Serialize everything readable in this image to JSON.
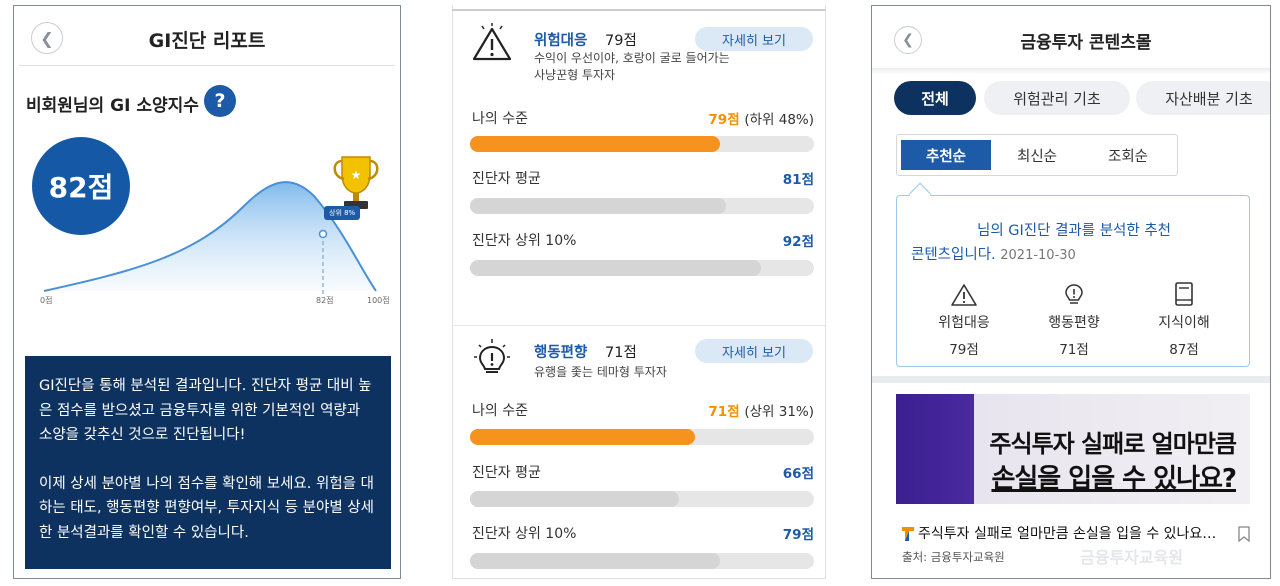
{
  "panel1": {
    "title": "GI진단 리포트",
    "index_title": "비회원님의 GI 소양지수",
    "help_symbol": "?",
    "score": "82점",
    "rank_badge": "상위 8%",
    "axis": {
      "min": "0점",
      "mark": "82점",
      "max": "100점"
    },
    "info_paragraph1": "GI진단을 통해 분석된 결과입니다. 진단자 평균 대비 높은 점수를 받으셨고 금융투자를 위한 기본적인 역량과 소양을 갖추신 것으로 진단됩니다!",
    "info_paragraph2": "이제 상세 분야별 나의 점수를 확인해 보세요. 위험을 대하는 태도, 행동편향 편향여부, 투자지식 등 분야별 상세한 분석결과를 확인할 수 있습니다."
  },
  "panel2": {
    "categories": [
      {
        "name": "위험대응",
        "score": "79점",
        "detail_button": "자세히 보기",
        "desc1": "수익이 우선이야, 호랑이 굴로 들어가는",
        "desc2": "사냥꾼형 투자자",
        "rows": [
          {
            "label": "나의 수준",
            "value": "79점",
            "sub": "(하위 48%)",
            "fraction": 0.79
          },
          {
            "label": "진단자 평균",
            "value": "81점",
            "fraction": 0.81
          },
          {
            "label": "진단자 상위 10%",
            "value": "92점",
            "fraction": 0.92
          }
        ]
      },
      {
        "name": "행동편향",
        "score": "71점",
        "detail_button": "자세히 보기",
        "desc1": "유행을 좇는 테마형 투자자",
        "rows": [
          {
            "label": "나의 수준",
            "value": "71점",
            "sub": "(상위 31%)",
            "fraction": 0.71
          },
          {
            "label": "진단자 평균",
            "value": "66점",
            "fraction": 0.66
          },
          {
            "label": "진단자 상위 10%",
            "value": "79점",
            "fraction": 0.79
          }
        ]
      }
    ],
    "colors": {
      "my_level": "#f6921e",
      "other": "#d5d5d5",
      "accent": "#1d5aa8"
    }
  },
  "panel3": {
    "title": "금융투자 콘텐츠몰",
    "chips": [
      "전체",
      "위험관리 기초",
      "자산배분 기초"
    ],
    "sort": [
      "추천순",
      "최신순",
      "조회순"
    ],
    "reco_line1": "님의 GI진단 결과를 분석한 추천",
    "reco_line2": "콘텐츠입니다.",
    "reco_date": "2021-10-30",
    "reco_items": [
      {
        "name": "위험대응",
        "score": "79점",
        "icon": "warning-icon"
      },
      {
        "name": "행동편향",
        "score": "71점",
        "icon": "lightbulb-icon"
      },
      {
        "name": "지식이해",
        "score": "87점",
        "icon": "book-icon"
      }
    ],
    "banner_line1": "주식투자 실패로 얼마만큼",
    "banner_line2": "손실을 입을 수 있나요?",
    "article_title": "주식투자 실패로 얼마만큼 손실을 입을 수 있나요…",
    "article_source": "출처: 금융투자교육원",
    "watermark": "금융투자교육원"
  }
}
